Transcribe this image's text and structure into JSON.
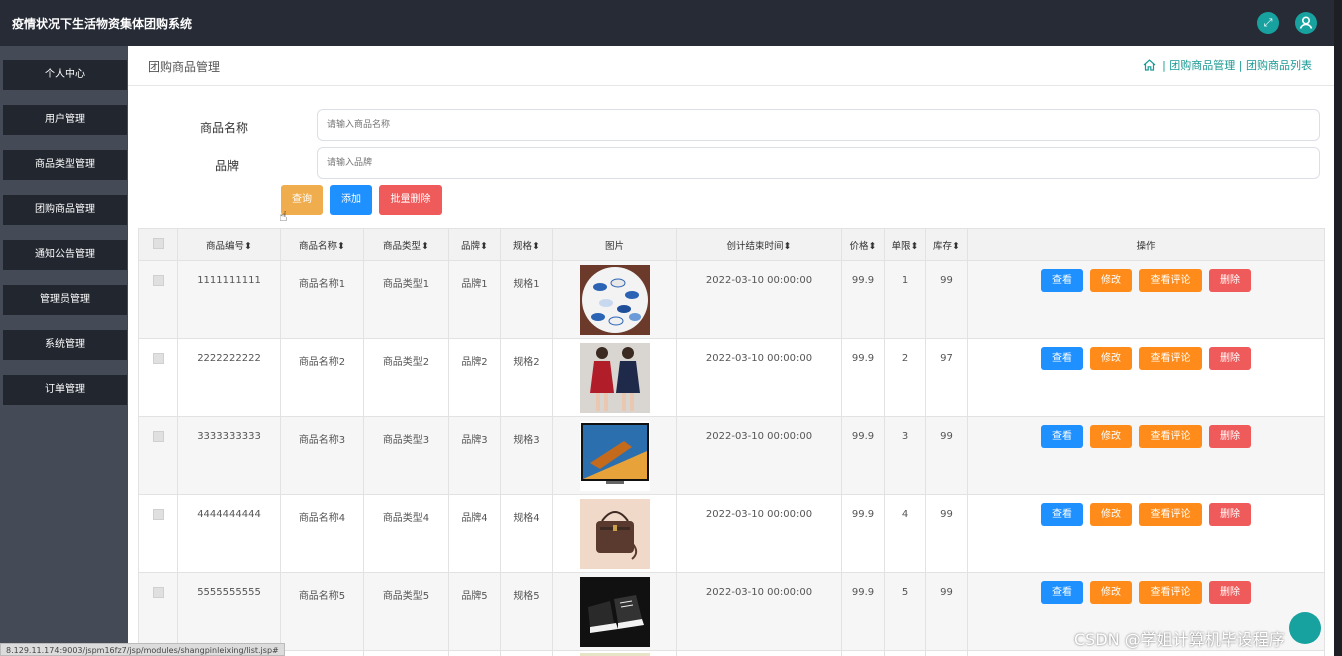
{
  "app": {
    "title": "疫情状况下生活物资集体团购系统"
  },
  "icons": {
    "fullscreen": "fullscreen-icon",
    "user": "user-icon",
    "home": "home-icon"
  },
  "sidebar": {
    "items": [
      "个人中心",
      "用户管理",
      "商品类型管理",
      "团购商品管理",
      "通知公告管理",
      "管理员管理",
      "系统管理",
      "订单管理"
    ]
  },
  "page": {
    "title": "团购商品管理"
  },
  "breadcrumb": {
    "item1": "团购商品管理",
    "item2": "团购商品列表",
    "sep": "|"
  },
  "search": {
    "name_label": "商品名称",
    "name_placeholder": "请输入商品名称",
    "brand_label": "品牌",
    "brand_placeholder": "请输入品牌"
  },
  "buttons": {
    "query": "查询",
    "add": "添加",
    "batch_delete": "批量删除"
  },
  "table": {
    "headers": [
      "商品编号",
      "商品名称",
      "商品类型",
      "品牌",
      "规格",
      "图片",
      "创计结束时间",
      "价格",
      "单限",
      "库存",
      "操作"
    ],
    "sort_icon": "sort-icon",
    "row_actions": {
      "view": "查看",
      "edit": "修改",
      "comments": "查看评论",
      "delete": "删除"
    },
    "rows": [
      {
        "id": "1111111111",
        "name": "商品名称1",
        "type": "商品类型1",
        "brand": "品牌1",
        "spec": "规格1",
        "time": "2022-03-10 00:00:00",
        "price": "99.9",
        "limit": "1",
        "stock": "99",
        "image": "candy-photo"
      },
      {
        "id": "2222222222",
        "name": "商品名称2",
        "type": "商品类型2",
        "brand": "品牌2",
        "spec": "规格2",
        "time": "2022-03-10 00:00:00",
        "price": "99.9",
        "limit": "2",
        "stock": "97",
        "image": "dress-photo"
      },
      {
        "id": "3333333333",
        "name": "商品名称3",
        "type": "商品类型3",
        "brand": "品牌3",
        "spec": "规格3",
        "time": "2022-03-10 00:00:00",
        "price": "99.9",
        "limit": "3",
        "stock": "99",
        "image": "tv-photo"
      },
      {
        "id": "4444444444",
        "name": "商品名称4",
        "type": "商品类型4",
        "brand": "品牌4",
        "spec": "规格4",
        "time": "2022-03-10 00:00:00",
        "price": "99.9",
        "limit": "4",
        "stock": "99",
        "image": "bag-photo"
      },
      {
        "id": "5555555555",
        "name": "商品名称5",
        "type": "商品类型5",
        "brand": "品牌5",
        "spec": "规格5",
        "time": "2022-03-10 00:00:00",
        "price": "99.9",
        "limit": "5",
        "stock": "99",
        "image": "shoes-photo"
      }
    ]
  },
  "status_url": "8.129.11.174:9003/jspm16fz7/jsp/modules/shangpinleixing/list.jsp#",
  "watermark": "CSDN @学姐计算机毕设程序",
  "colors": {
    "accent": "#17a2a0",
    "sidebar_bg": "#444a56",
    "topbar_bg": "#262b36",
    "blue": "#1e90ff",
    "orange": "#ff8c1a",
    "red": "#ef5b5b"
  }
}
